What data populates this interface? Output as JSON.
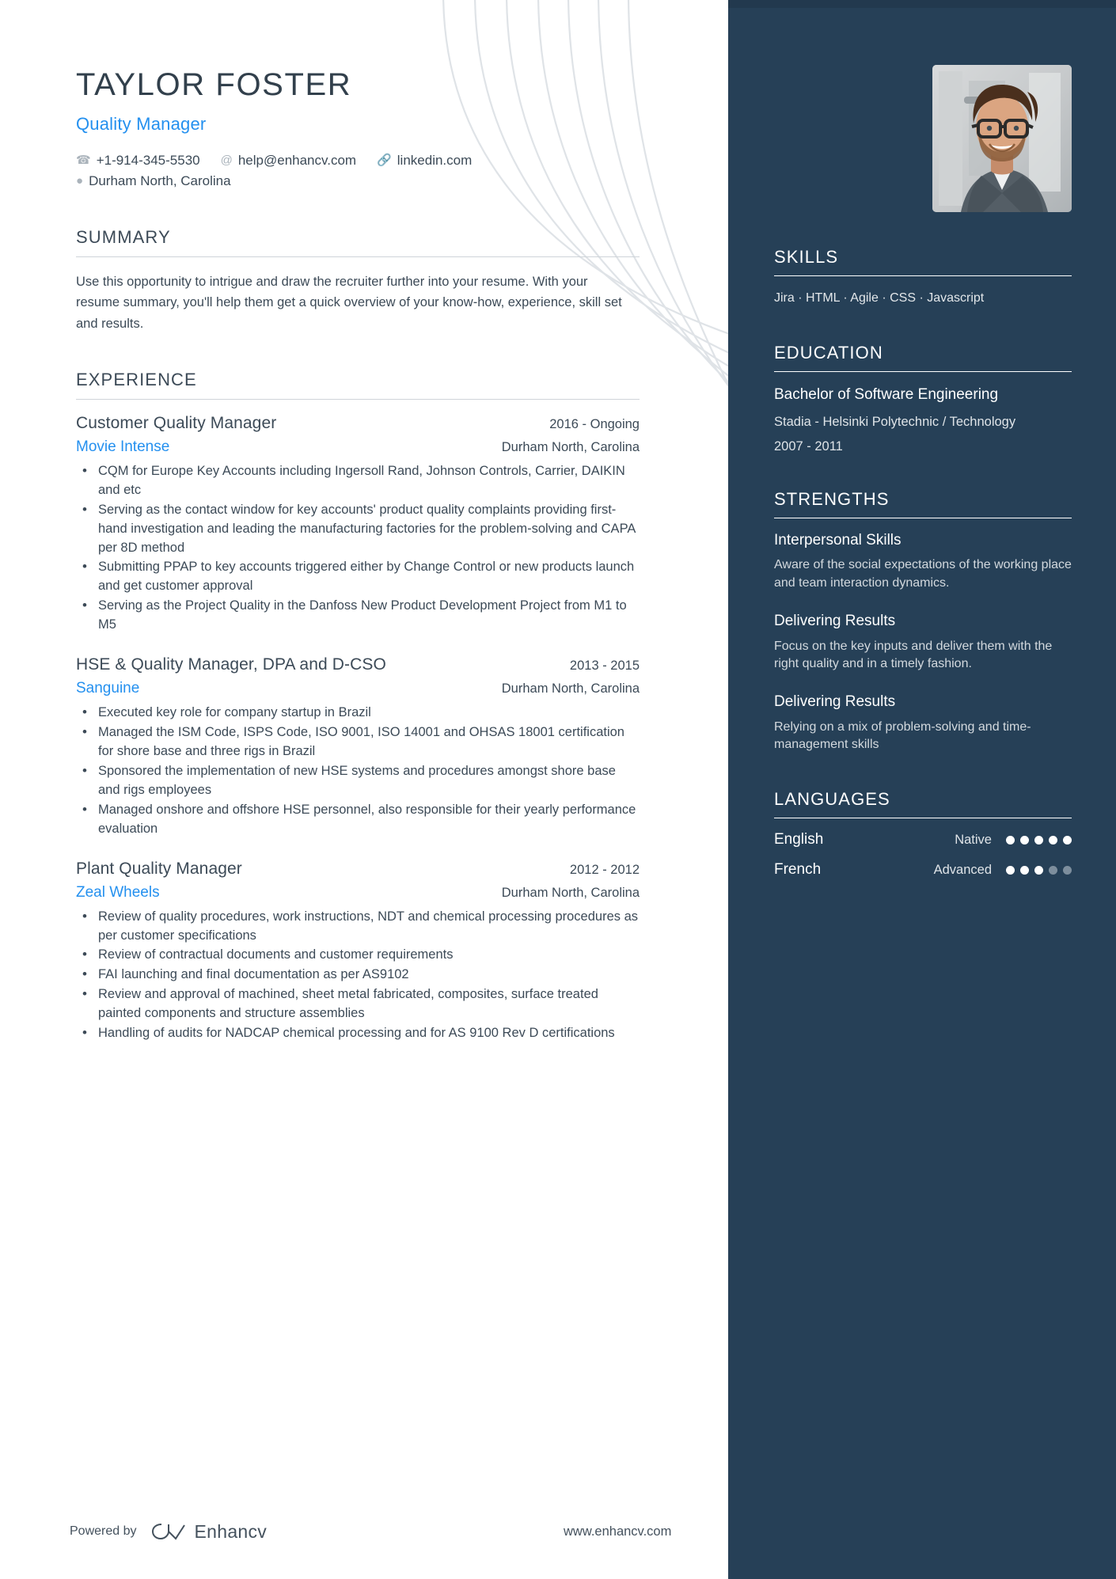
{
  "theme": {
    "sidebar_bg": "#264057",
    "accent": "#2490ef",
    "text": "#3c4a57",
    "rule": "#cfd4d9"
  },
  "header": {
    "name": "TAYLOR FOSTER",
    "job_title": "Quality Manager",
    "contacts": {
      "phone": "+1-914-345-5530",
      "email": "help@enhancv.com",
      "link": "linkedin.com",
      "location": "Durham North, Carolina"
    },
    "icons": {
      "phone": "phone-icon",
      "email": "at-sign-icon",
      "link": "link-icon",
      "location": "map-pin-icon"
    }
  },
  "summary": {
    "title": "SUMMARY",
    "text": "Use this opportunity to intrigue and draw the recruiter further into your resume. With your resume summary, you'll help them get a quick overview of your know-how, experience, skill set and results."
  },
  "experience": {
    "title": "EXPERIENCE",
    "jobs": [
      {
        "role": "Customer Quality Manager",
        "dates": "2016 - Ongoing",
        "company": "Movie Intense",
        "location": "Durham North, Carolina",
        "bullets": [
          "CQM for Europe Key Accounts including Ingersoll Rand, Johnson Controls, Carrier, DAIKIN and etc",
          "Serving as the contact window for key accounts' product quality complaints providing first-hand investigation and leading the manufacturing factories for the problem-solving and CAPA per 8D method",
          "Submitting PPAP to key accounts triggered either by Change Control or new products launch and get customer approval",
          "Serving as the Project Quality in the Danfoss New Product Development Project from M1 to M5"
        ]
      },
      {
        "role": "HSE & Quality Manager, DPA and D-CSO",
        "dates": "2013 - 2015",
        "company": "Sanguine",
        "location": "Durham North, Carolina",
        "bullets": [
          "Executed key role for company startup in Brazil",
          "Managed the ISM Code, ISPS Code, ISO 9001, ISO 14001 and OHSAS 18001 certification for shore base and three rigs in Brazil",
          "Sponsored the implementation of new HSE systems and procedures amongst shore base and rigs employees",
          "Managed onshore and offshore HSE personnel, also responsible for their yearly performance evaluation"
        ]
      },
      {
        "role": "Plant Quality Manager",
        "dates": "2012 - 2012",
        "company": "Zeal Wheels",
        "location": "Durham North, Carolina",
        "bullets": [
          "Review of quality procedures, work instructions, NDT and chemical processing procedures as per customer specifications",
          "Review of contractual documents and customer requirements",
          "FAI launching and final documentation as per AS9102",
          "Review and approval of machined, sheet metal fabricated, composites, surface treated painted components and structure assemblies",
          "Handling of audits for NADCAP chemical processing and for AS 9100 Rev D certifications"
        ]
      }
    ]
  },
  "sidebar": {
    "photo_alt": "profile-photo",
    "skills": {
      "title": "SKILLS",
      "text": "Jira · HTML · Agile · CSS · Javascript"
    },
    "education": {
      "title": "EDUCATION",
      "degree": "Bachelor of Software Engineering",
      "school": "Stadia - Helsinki Polytechnic / Technology",
      "dates": "2007 - 2011"
    },
    "strengths": {
      "title": "STRENGTHS",
      "items": [
        {
          "name": "Interpersonal Skills",
          "text": "Aware of the social expectations of the working place and team interaction dynamics."
        },
        {
          "name": "Delivering Results",
          "text": "Focus on the key inputs and deliver them with the right quality and in a timely fashion."
        },
        {
          "name": "Delivering Results",
          "text": "Relying on a mix of problem-solving and time-management skills"
        }
      ]
    },
    "languages": {
      "title": "LANGUAGES",
      "items": [
        {
          "name": "English",
          "level": "Native",
          "rating": 5,
          "max": 5
        },
        {
          "name": "French",
          "level": "Advanced",
          "rating": 3,
          "max": 5
        }
      ]
    }
  },
  "footer": {
    "powered_by": "Powered by",
    "brand": "Enhancv",
    "site": "www.enhancv.com"
  }
}
